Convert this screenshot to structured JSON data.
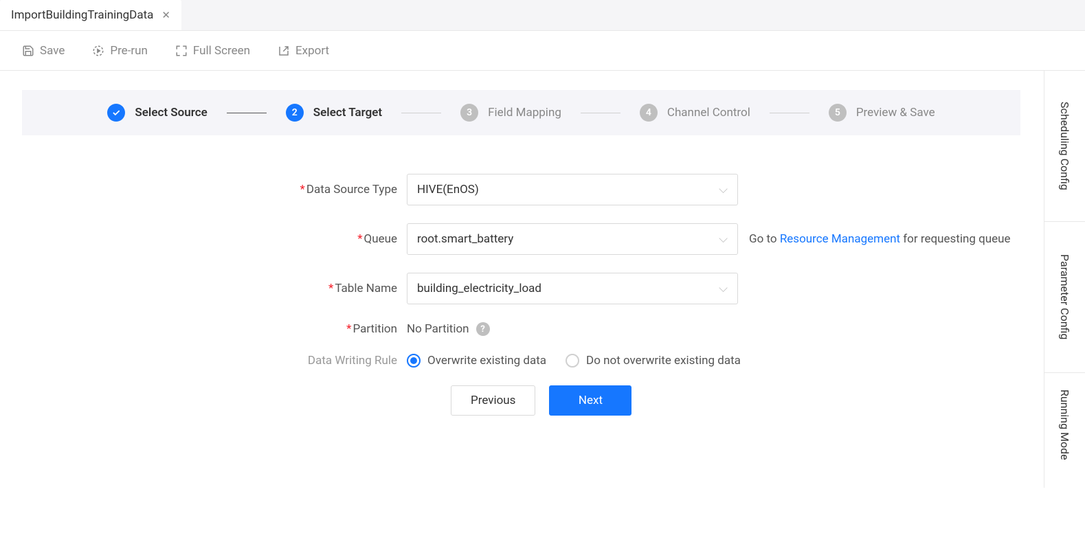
{
  "tab": {
    "title": "ImportBuildingTrainingData"
  },
  "toolbar": {
    "save": "Save",
    "prerun": "Pre-run",
    "fullscreen": "Full Screen",
    "export": "Export"
  },
  "steps": [
    {
      "label": "Select Source",
      "state": "done"
    },
    {
      "num": "2",
      "label": "Select Target",
      "state": "active"
    },
    {
      "num": "3",
      "label": "Field Mapping",
      "state": "pending"
    },
    {
      "num": "4",
      "label": "Channel Control",
      "state": "pending"
    },
    {
      "num": "5",
      "label": "Preview & Save",
      "state": "pending"
    }
  ],
  "form": {
    "dataSourceType": {
      "label": "Data Source Type",
      "value": "HIVE(EnOS)"
    },
    "queue": {
      "label": "Queue",
      "value": "root.smart_battery",
      "hintPrefix": "Go to ",
      "hintLink": "Resource Management",
      "hintSuffix": " for requesting queue"
    },
    "tableName": {
      "label": "Table Name",
      "value": "building_electricity_load"
    },
    "partition": {
      "label": "Partition",
      "value": "No Partition"
    },
    "writingRule": {
      "label": "Data Writing Rule",
      "opt1": "Overwrite existing data",
      "opt2": "Do not overwrite existing data"
    }
  },
  "buttons": {
    "previous": "Previous",
    "next": "Next"
  },
  "sideTabs": {
    "scheduling": "Scheduling Config",
    "parameter": "Parameter Config",
    "running": "Running Mode"
  }
}
